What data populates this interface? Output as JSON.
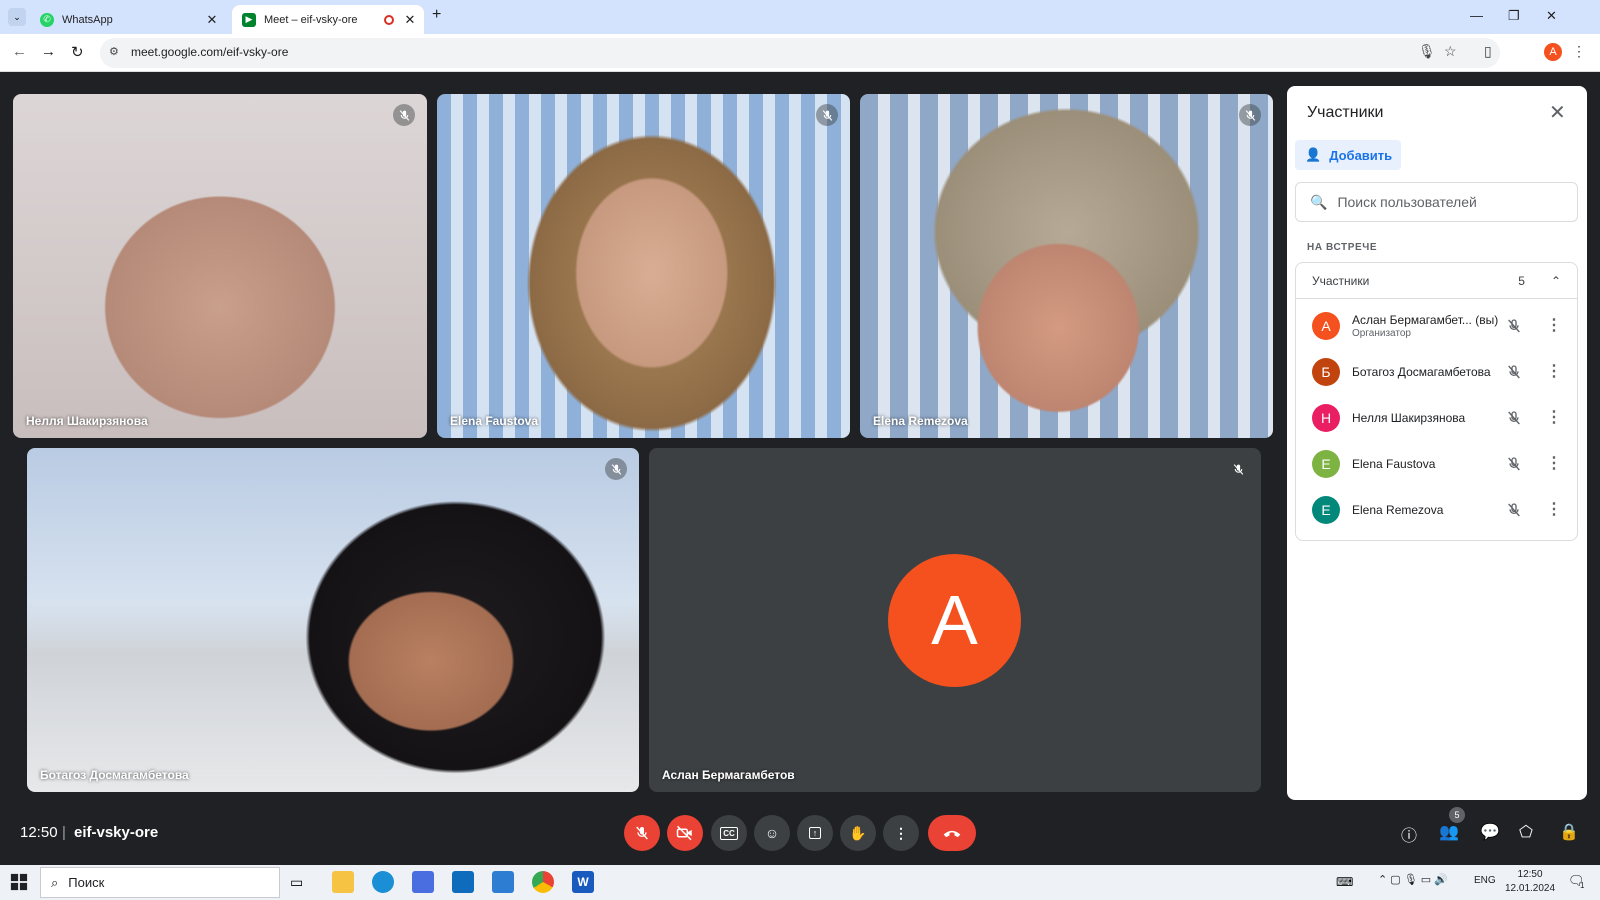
{
  "browser": {
    "tabs": [
      {
        "title": "WhatsApp",
        "icon": "whatsapp-icon"
      },
      {
        "title": "Meet – eif-vsky-ore",
        "icon": "meet-icon",
        "recording": true
      }
    ],
    "url": "meet.google.com/eif-vsky-ore",
    "profile_initial": "A"
  },
  "tiles": [
    {
      "name": "Нелля Шакирзянова",
      "muted": true
    },
    {
      "name": "Elena Faustova",
      "muted": true
    },
    {
      "name": "Elena Remezova",
      "muted": true
    },
    {
      "name": "Ботагоз Досмагамбетова",
      "muted": true
    },
    {
      "name": "Аслан Бермагамбетов",
      "muted": true,
      "avatar": "A"
    }
  ],
  "panel": {
    "title": "Участники",
    "add_label": "Добавить",
    "search_placeholder": "Поиск пользователей",
    "section_label": "НА ВСТРЕЧЕ",
    "group_label": "Участники",
    "group_count": "5",
    "participants": [
      {
        "initial": "А",
        "name": "Аслан Бермагамбет... (вы)",
        "role": "Организатор",
        "color": "#f4511e"
      },
      {
        "initial": "Б",
        "name": "Ботагоз Досмагамбетова",
        "role": "",
        "color": "#c1440e"
      },
      {
        "initial": "Н",
        "name": "Нелля Шакирзянова",
        "role": "",
        "color": "#e91e63"
      },
      {
        "initial": "E",
        "name": "Elena Faustova",
        "role": "",
        "color": "#7cb342"
      },
      {
        "initial": "E",
        "name": "Elena Remezova",
        "role": "",
        "color": "#00897b"
      }
    ]
  },
  "bottom": {
    "time": "12:50",
    "meeting_code": "eif-vsky-ore",
    "people_count": "5"
  },
  "taskbar": {
    "search_label": "Поиск",
    "lang": "ENG",
    "clock_time": "12:50",
    "clock_date": "12.01.2024",
    "notifications": "1"
  }
}
